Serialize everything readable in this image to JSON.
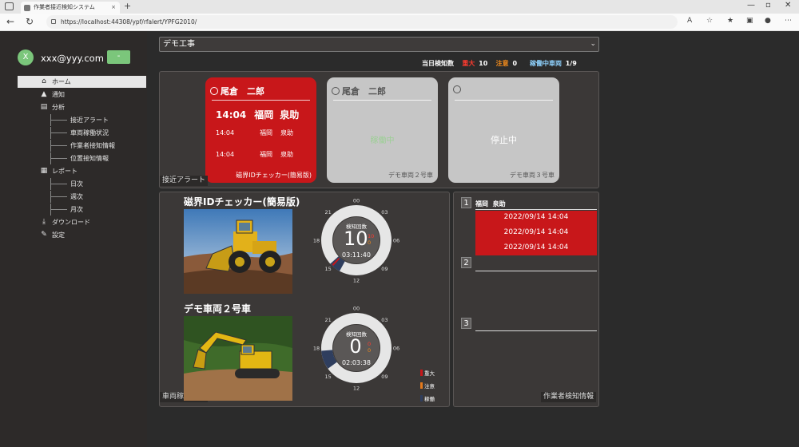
{
  "browser": {
    "tab_title": "作業者接近検知システム",
    "url": "https://localhost:44308/ypf/rfalert/YPFG2010/"
  },
  "user": {
    "avatar_letter": "X",
    "email": "xxx@yyy.com",
    "button_label": "-"
  },
  "nav": [
    {
      "label": "ホーム",
      "icon": "home-icon",
      "active": true
    },
    {
      "label": "通知",
      "icon": "bell-icon"
    },
    {
      "label": "分析",
      "icon": "chart-icon"
    },
    {
      "label": "接近アラート",
      "sub": true
    },
    {
      "label": "車両稼働状況",
      "sub": true
    },
    {
      "label": "作業者接知情報",
      "sub": true
    },
    {
      "label": "位置接知情報",
      "sub": true
    },
    {
      "label": "レポート",
      "icon": "report-icon"
    },
    {
      "label": "日次",
      "sub": true
    },
    {
      "label": "週次",
      "sub": true
    },
    {
      "label": "月次",
      "sub": true
    },
    {
      "label": "ダウンロード",
      "icon": "download-icon"
    },
    {
      "label": "設定",
      "icon": "wrench-icon"
    }
  ],
  "project_select": {
    "value": "デモ工事"
  },
  "summary": {
    "label": "当日検知数",
    "severe_label": "重大",
    "severe_count": "10",
    "caution_label": "注意",
    "caution_count": "0",
    "active_label": "稼働中車両",
    "active_count": "1/9"
  },
  "alerts_panel": {
    "label": "接近アラート",
    "cards": [
      {
        "driver": "尾倉　二郎",
        "status": "",
        "rows": [
          {
            "time": "14:04",
            "pref": "福岡",
            "name": "泉助"
          },
          {
            "time": "14:04",
            "pref": "福岡",
            "name": "泉助"
          },
          {
            "time": "14:04",
            "pref": "福岡",
            "name": "泉助"
          }
        ],
        "footer": "磁界IDチェッカー(簡易版)",
        "color": "#c8171a"
      },
      {
        "driver": "尾倉　二郎",
        "status": "稼働中",
        "rows": [],
        "footer": "デモ車両２号車",
        "color": "#c6c6c6"
      },
      {
        "driver": "",
        "status": "停止中",
        "rows": [],
        "footer": "デモ車両３号車",
        "color": "#c6c6c6"
      }
    ]
  },
  "vehicles_panel": {
    "label": "車両稼働状況",
    "vehicles": [
      {
        "name": "磁界IDチェッカー(簡易版)",
        "photo": "wheel-loader",
        "count_label": "検知回数",
        "count": "10",
        "severe": "10",
        "caution": "0",
        "time": "03:11:40",
        "operating_arc": [
          13.9,
          15.2
        ],
        "alert_arc": [
          14.8,
          15.0
        ]
      },
      {
        "name": "デモ車両２号車",
        "photo": "excavator",
        "count_label": "検知回数",
        "count": "0",
        "severe": "0",
        "caution": "0",
        "time": "02:03:38",
        "operating_arc": [
          15.6,
          17.7
        ],
        "alert_arc": null
      }
    ],
    "hours": [
      "00",
      "03",
      "06",
      "09",
      "12",
      "15",
      "18",
      "21"
    ],
    "legend": [
      {
        "label": "重大",
        "color": "#c8171a"
      },
      {
        "label": "注意",
        "color": "#e57a1c"
      },
      {
        "label": "稼働",
        "color": "#2f3e5e"
      }
    ]
  },
  "workers_panel": {
    "label": "作業者検知情報",
    "worker_name_pref": "福岡",
    "worker_name": "泉助",
    "entries": [
      "2022/09/14 14:04",
      "2022/09/14 14:04",
      "2022/09/14 14:04"
    ],
    "slots": [
      "1",
      "2",
      "3"
    ]
  }
}
